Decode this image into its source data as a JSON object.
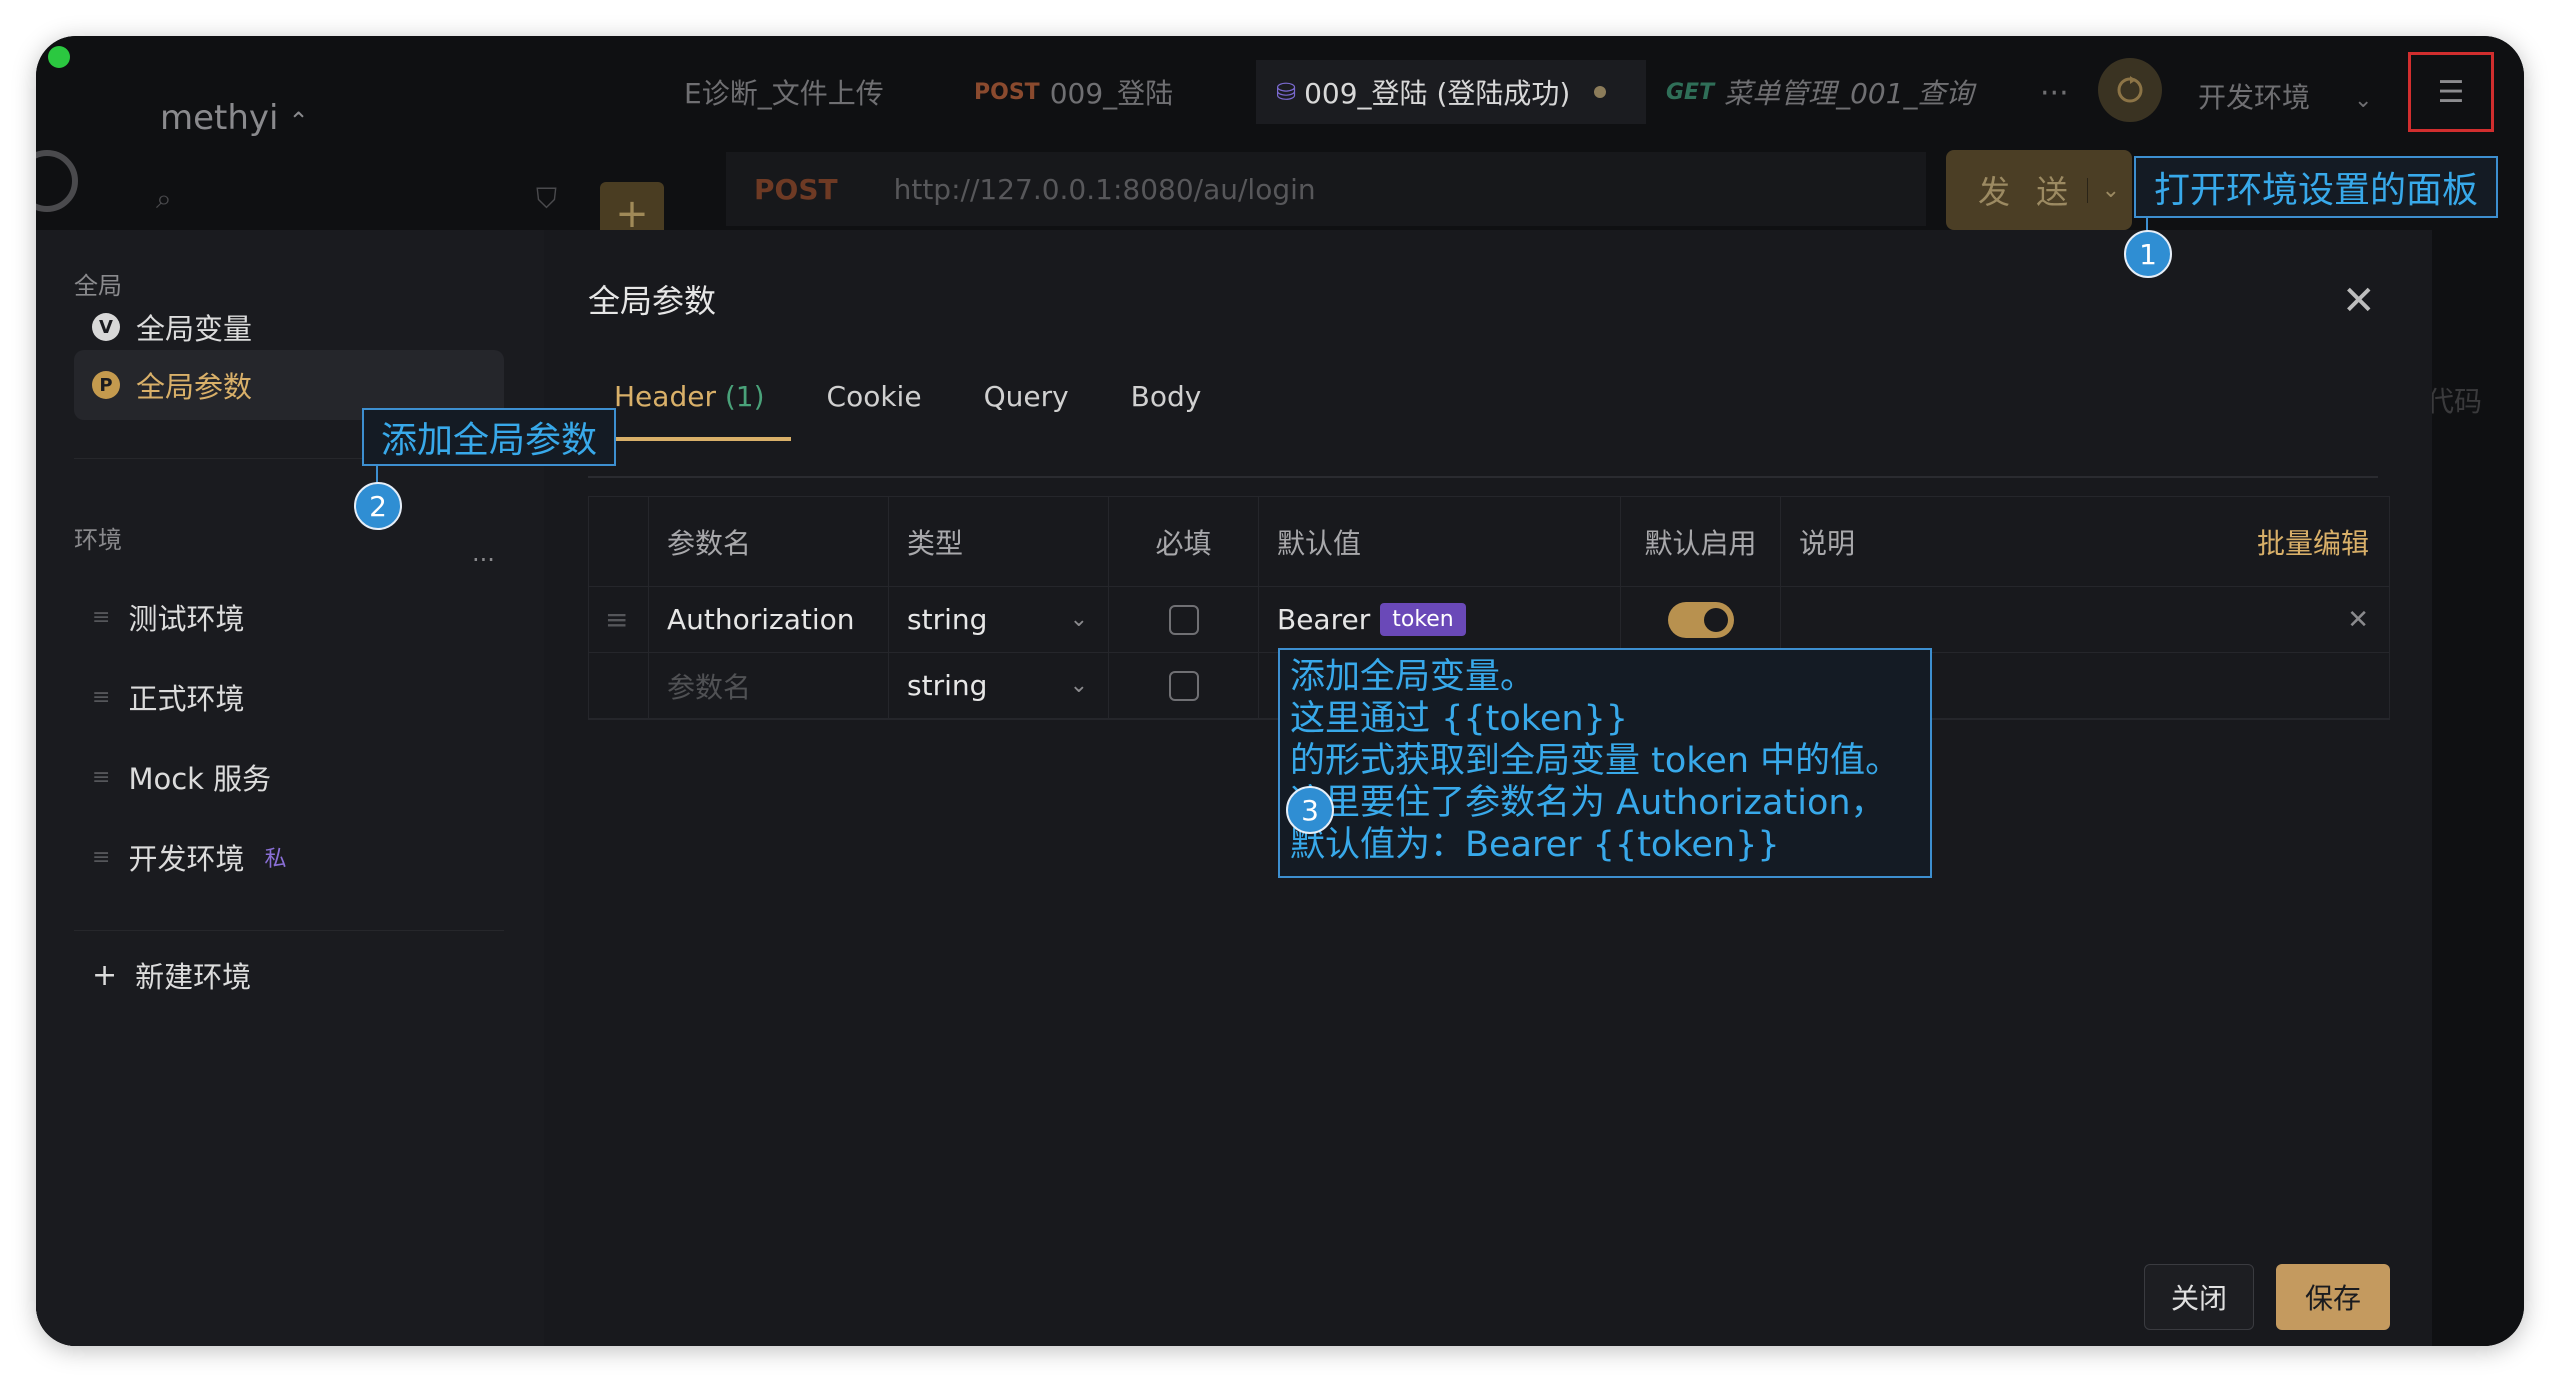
{
  "app": {
    "workspace": "methyi",
    "top_tabs": [
      {
        "method": "",
        "label": "E诊断_文件上传"
      },
      {
        "method": "POST",
        "label": "009_登陆"
      },
      {
        "method": "",
        "label": "009_登陆 (登陆成功)"
      },
      {
        "method": "GET",
        "label": "菜单管理_001_查询"
      }
    ],
    "more": "···",
    "env_selected": "开发环境",
    "url_method": "POST",
    "url": "http://127.0.0.1:8080/au/login",
    "send_label": "发 送",
    "ghost_code": "代码"
  },
  "modal": {
    "title": "全局参数",
    "sidebar": {
      "global_heading": "全局",
      "global_items": [
        {
          "badge": "V",
          "label": "全局变量"
        },
        {
          "badge": "P",
          "label": "全局参数"
        }
      ],
      "env_heading": "环境",
      "env_more": "···",
      "envs": [
        {
          "label": "测试环境",
          "tag": ""
        },
        {
          "label": "正式环境",
          "tag": ""
        },
        {
          "label": "Mock 服务",
          "tag": ""
        },
        {
          "label": "开发环境",
          "tag": "私"
        }
      ],
      "new_env": "新建环境"
    },
    "tabs": [
      {
        "label": "Header",
        "count": "(1)"
      },
      {
        "label": "Cookie",
        "count": ""
      },
      {
        "label": "Query",
        "count": ""
      },
      {
        "label": "Body",
        "count": ""
      }
    ],
    "table": {
      "headers": [
        "参数名",
        "类型",
        "必填",
        "默认值",
        "默认启用",
        "说明"
      ],
      "bulk_edit": "批量编辑",
      "rows": [
        {
          "name": "Authorization",
          "type": "string",
          "required": false,
          "default_text": "Bearer",
          "default_tag": "token",
          "enabled": true
        },
        {
          "name_placeholder": "参数名",
          "type": "string",
          "required": false,
          "enabled": true
        }
      ]
    },
    "close_label": "关闭",
    "save_label": "保存"
  },
  "annotations": {
    "n1": "1",
    "a1": "打开环境设置的面板",
    "n2": "2",
    "a2": "添加全局参数",
    "n3": "3",
    "a3_lines": [
      "添加全局变量。",
      "这里通过 {{token}}",
      " 的形式获取到全局变量 token 中的值。",
      "这里要住了参数名为 Authorization，",
      "默认值为：Bearer {{token}}"
    ]
  },
  "colors": {
    "accent": "#d9b069",
    "annotation": "#38a9ea",
    "token_tag": "#6a49b8",
    "highlight_border": "#d12e2e"
  }
}
